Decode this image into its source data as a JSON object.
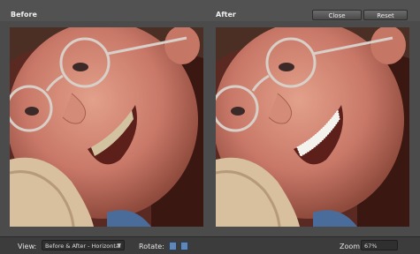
{
  "header": {
    "before_label": "Before",
    "after_label": "After",
    "close_label": "Close",
    "reset_label": "Reset"
  },
  "footer": {
    "view_label": "View:",
    "view_value": "Before & After - Horizontal",
    "rotate_label": "Rotate:",
    "zoom_label": "Zoom:",
    "zoom_value": "67%"
  },
  "icons": {
    "rotate_left": "rotate-left-icon",
    "rotate_right": "rotate-right-icon",
    "view_dropdown": "chevron-down-icon"
  }
}
